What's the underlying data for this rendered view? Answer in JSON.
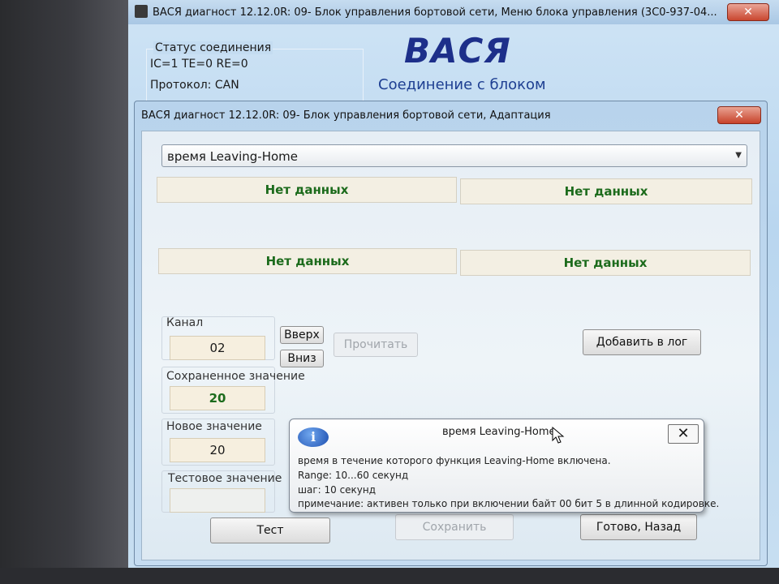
{
  "main_window": {
    "title": "ВАСЯ диагност 12.12.0R: 09- Блок управления бортовой сети,  Меню блока управления (3С0-937-04...",
    "close_glyph": "✕",
    "status_group": {
      "legend": "Статус соединения",
      "counters": "IC=1  TE=0   RE=0",
      "protocol": "Протокол: CAN"
    },
    "logo": "ВАСЯ",
    "connection_label": "Соединение с блоком"
  },
  "dialog": {
    "title": "ВАСЯ диагност 12.12.0R: 09- Блок управления бортовой сети, Адаптация",
    "close_glyph": "✕",
    "channel_select": {
      "value": "время Leaving-Home"
    },
    "data_boxes": [
      "Нет данных",
      "Нет данных",
      "Нет данных",
      "Нет данных"
    ],
    "channel": {
      "label": "Канал",
      "value": "02",
      "up_label": "Вверх",
      "down_label": "Вниз",
      "read_label": "Прочитать"
    },
    "add_to_log_label": "Добавить в лог",
    "saved_value": {
      "label": "Сохраненное значение",
      "value": "20"
    },
    "new_value": {
      "label": "Новое значение",
      "value": "20"
    },
    "test_value": {
      "label": "Тестовое значение",
      "value": ""
    },
    "buttons": {
      "test": "Тест",
      "save": "Сохранить",
      "done_back": "Готово, Назад"
    }
  },
  "tooltip": {
    "icon": "info-icon",
    "title": "время Leaving-Home",
    "close_glyph": "✕",
    "lines": [
      "время в течение которого функция Leaving-Home включена.",
      "Range: 10...60 секунд",
      "шаг: 10 секунд",
      "примечание: активен только при включении байт 00 бит 5 в длинной кодировке."
    ]
  },
  "colors": {
    "data_text": "#1c6b1c",
    "logo": "#1d2f8a",
    "close_button": "#c7422a"
  }
}
